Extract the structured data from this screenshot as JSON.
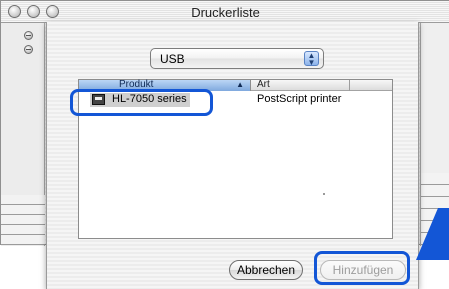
{
  "window": {
    "title": "Druckerliste"
  },
  "popup": {
    "selected": "USB"
  },
  "list": {
    "columns": [
      "Produkt",
      "Art"
    ],
    "rows": [
      {
        "produkt": "HL-7050 series",
        "art": "PostScript printer"
      }
    ]
  },
  "buttons": {
    "cancel": "Abbrechen",
    "add": "Hinzufügen"
  },
  "colors": {
    "highlight": "#1356d6",
    "selection": "#cfcfcf",
    "header_selected": "#8fb5e6"
  },
  "icons": [
    "close-window-icon",
    "minimize-window-icon",
    "zoom-window-icon",
    "printer-icon",
    "sort-ascending-icon",
    "popup-arrows-icon",
    "pointer-arrow-icon"
  ]
}
